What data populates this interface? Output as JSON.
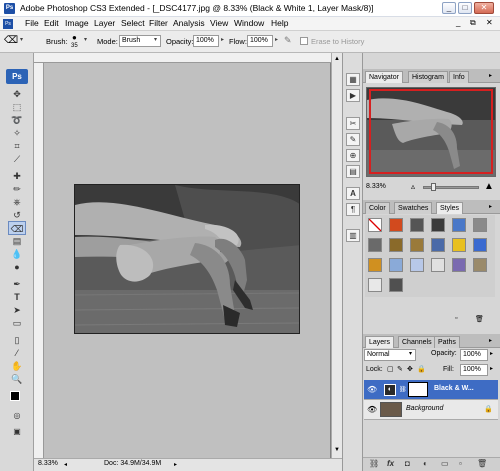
{
  "window": {
    "title": "Adobe Photoshop CS3 Extended - [_DSC4177.jpg @ 8.33% (Black & White 1, Layer Mask/8)]",
    "app_icon": "Ps",
    "buttons": {
      "minimize": "_",
      "maximize": "□",
      "close": "✕"
    }
  },
  "menu": {
    "icon": "Ps",
    "items": [
      "File",
      "Edit",
      "Image",
      "Layer",
      "Select",
      "Filter",
      "Analysis",
      "View",
      "Window",
      "Help"
    ],
    "doc_buttons": {
      "minimize": "_",
      "restore": "⧉",
      "close": "✕"
    }
  },
  "options": {
    "brush_label": "Brush:",
    "brush_size": "35",
    "mode_label": "Mode:",
    "mode_value": "Brush",
    "opacity_label": "Opacity:",
    "opacity_value": "100%",
    "flow_label": "Flow:",
    "flow_value": "100%",
    "erase_history_label": "Erase to History"
  },
  "toolbox": {
    "logo": "Ps"
  },
  "status": {
    "zoom": "8.33%",
    "doc": "Doc: 34.9M/34.9M"
  },
  "navigator": {
    "tabs": [
      "Navigator",
      "Histogram",
      "Info"
    ],
    "zoom": "8.33%"
  },
  "swatch_panel": {
    "tabs": [
      "Color",
      "Swatches",
      "Styles"
    ],
    "styles": [
      {
        "color": "#ffffff",
        "none": true
      },
      {
        "color": "#d24a1e"
      },
      {
        "color": "#555555"
      },
      {
        "color": "#3a3a3a"
      },
      {
        "color": "#4a78c8"
      },
      {
        "color": "#8a8a8a"
      },
      {
        "color": "#6a6a6a"
      },
      {
        "color": "#8a6a2a"
      },
      {
        "color": "#9a7a3a"
      },
      {
        "color": "#4a6aa8"
      },
      {
        "color": "#e8c020"
      },
      {
        "color": "#3a6ad0"
      },
      {
        "color": "#d09020"
      },
      {
        "color": "#8aaad8"
      },
      {
        "color": "#b8c8e8"
      },
      {
        "color": "#e0e0e0"
      },
      {
        "color": "#7a6ab0"
      },
      {
        "color": "#9a8a6a"
      },
      {
        "color": "#e8e8e8"
      },
      {
        "color": "#505050"
      }
    ]
  },
  "layers": {
    "tabs": [
      "Layers",
      "Channels",
      "Paths"
    ],
    "blend_mode": "Normal",
    "opacity_label": "Opacity:",
    "opacity_value": "100%",
    "lock_label": "Lock:",
    "fill_label": "Fill:",
    "fill_value": "100%",
    "items": [
      {
        "name": "Black & W...",
        "selected": true
      },
      {
        "name": "Background",
        "selected": false
      }
    ],
    "footer_icons": [
      "link-icon",
      "fx-icon",
      "mask-icon",
      "adjustment-icon",
      "folder-icon",
      "new-layer-icon",
      "trash-icon"
    ]
  }
}
